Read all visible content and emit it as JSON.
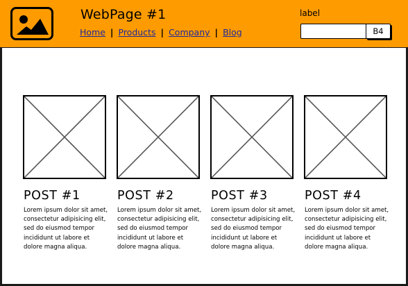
{
  "header": {
    "title": "WebPage #1",
    "logo_icon": "image-icon",
    "background": "#fe9b00",
    "nav": [
      "Home",
      "Products",
      "Company",
      "Blog"
    ],
    "nav_separator": "|",
    "search": {
      "label": "label",
      "value": "",
      "button": "B4"
    }
  },
  "posts": [
    {
      "title": "POST #1",
      "body": "Lorem ipsum dolor sit amet, consectetur adipisicing elit, sed do eiusmod tempor incididunt ut labore et dolore magna aliqua.",
      "image_icon": "image-placeholder-icon"
    },
    {
      "title": "POST #2",
      "body": "Lorem ipsum dolor sit amet, consectetur adipisicing elit, sed do eiusmod tempor incididunt ut labore et dolore magna aliqua.",
      "image_icon": "image-placeholder-icon"
    },
    {
      "title": "POST #3",
      "body": "Lorem ipsum dolor sit amet, consectetur adipisicing elit, sed do eiusmod tempor incididunt ut labore et dolore magna aliqua.",
      "image_icon": "image-placeholder-icon"
    },
    {
      "title": "POST #4",
      "body": "Lorem ipsum dolor sit amet, consectetur adipisicing elit, sed do eiusmod tempor incididunt ut labore et dolore magna aliqua.",
      "image_icon": "image-placeholder-icon"
    }
  ]
}
